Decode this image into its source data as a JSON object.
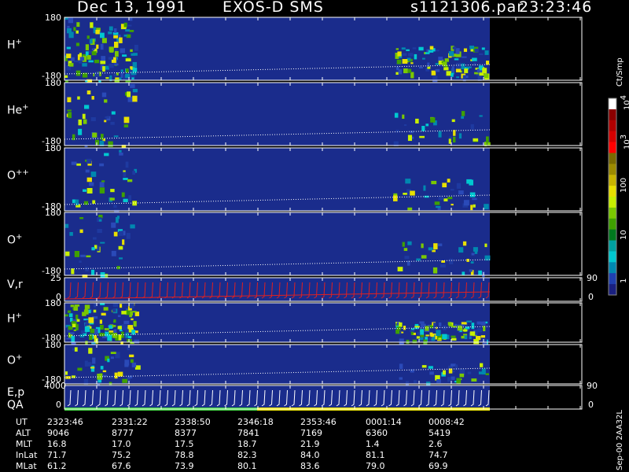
{
  "header": {
    "date": "Dec 13, 1991",
    "instrument": "EXOS-D SMS",
    "file": "s1121306.par",
    "time": "23:23:46"
  },
  "colorbar": {
    "unit": "Ct/Smp",
    "ticks": [
      "10",
      "10",
      "100",
      "10",
      "1"
    ],
    "tick_exp": [
      "4",
      "3",
      "",
      "",
      ""
    ],
    "colors": [
      "#ffffff",
      "#8b0000",
      "#b00000",
      "#d40000",
      "#ff0000",
      "#7a6a00",
      "#9c8a00",
      "#c8b400",
      "#e8e000",
      "#c8f000",
      "#7ac800",
      "#3fa000",
      "#00781e",
      "#00a0a0",
      "#00c8d0",
      "#0088b0",
      "#2040b0",
      "#1a2080"
    ]
  },
  "chart_data": {
    "type": "heatmap",
    "panels": [
      {
        "label": "H",
        "sup": "+",
        "ymax": "180",
        "ymin": "-180"
      },
      {
        "label": "He",
        "sup": "+",
        "ymax": "180",
        "ymin": "-180"
      },
      {
        "label": "O",
        "sup": "++",
        "ymax": "180",
        "ymin": "-180"
      },
      {
        "label": "O",
        "sup": "+",
        "ymax": "180",
        "ymin": "-180"
      },
      {
        "label": "V,r",
        "sup": "",
        "ymax": "25",
        "ymin": "0",
        "right_top": "90",
        "right_bot": "0"
      },
      {
        "label": "H",
        "sup": "+",
        "ymax": "180",
        "ymin": "-180"
      },
      {
        "label": "O",
        "sup": "+",
        "ymax": "180",
        "ymin": "-180"
      },
      {
        "label": "E,p",
        "label2": "QA",
        "sup": "",
        "ymax": "4000",
        "ymin": "0",
        "right_top": "90",
        "right_bot": "0"
      }
    ],
    "x_times": [
      "2323:46",
      "2331:22",
      "2338:50",
      "2346:18",
      "2353:46",
      "0001:14",
      "0008:42"
    ]
  },
  "footer": {
    "rows": [
      {
        "label": "UT",
        "values": [
          "2323:46",
          "2331:22",
          "2338:50",
          "2346:18",
          "2353:46",
          "0001:14",
          "0008:42"
        ]
      },
      {
        "label": "ALT",
        "values": [
          "9046",
          "8777",
          "8377",
          "7841",
          "7169",
          "6360",
          "5419"
        ]
      },
      {
        "label": "MLT",
        "values": [
          "16.8",
          "17.0",
          "17.5",
          "18.7",
          "21.9",
          "1.4",
          "2.6"
        ]
      },
      {
        "label": "InLat",
        "values": [
          "71.7",
          "75.2",
          "78.8",
          "82.3",
          "84.0",
          "81.1",
          "74.7"
        ]
      },
      {
        "label": "MLat",
        "values": [
          "61.2",
          "67.6",
          "73.9",
          "80.1",
          "83.6",
          "79.0",
          "69.9"
        ]
      }
    ],
    "stamp": "Sep-00 2AA32L"
  }
}
